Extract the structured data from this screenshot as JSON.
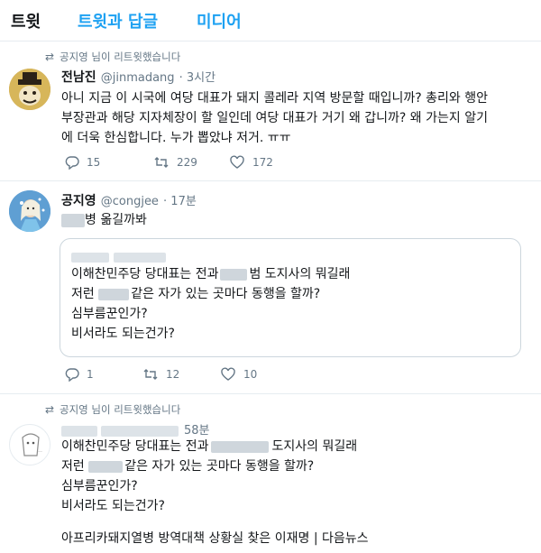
{
  "tabs": [
    "트윗",
    "트윗과 답글",
    "미디어"
  ],
  "tweet1": {
    "retweet_note": "공지영 님이 리트윗했습니다",
    "name": "전남진",
    "handle": "@jinmadang",
    "time": "· 3시간",
    "lines": [
      "아니 지금 이 시국에 여당 대표가 돼지 콜레라 지역 방문할 때입니까? 총리와 행안",
      "부장관과 해당 지자체장이 할 일인데 여당 대표가 거기 왜 갑니까? 왜 가는지 알기",
      "에 더욱 한심합니다. 누가 뽑았냐 저거. ㅠㅠ"
    ],
    "replies": "15",
    "retweets": "229",
    "likes": "172"
  },
  "tweet2": {
    "name": "공지영",
    "handle": "@congjee",
    "time": "· 17분",
    "text_suffix": "병 옮길까봐",
    "quote_lines": [
      [
        "이해찬민주당 당대표는 전과",
        "범 도지사의 뭐길래"
      ],
      [
        "저런 ",
        "같은 자가 있는 곳마다 동행을 할까?"
      ],
      [
        "심부름꾼인가?"
      ],
      [
        "비서라도 되는건가?"
      ]
    ],
    "replies": "1",
    "retweets": "12",
    "likes": "10"
  },
  "tweet3": {
    "retweet_note": "공지영 님이 리트윗했습니다",
    "time": "58분",
    "lines": [
      [
        "이해찬민주당 당대표는 전과",
        "도지사의 뭐길래"
      ],
      [
        "저런 ",
        "같은 자가 있는 곳마다 동행을 할까?"
      ],
      [
        "심부름꾼인가?"
      ],
      [
        "비서라도 되는건가?"
      ]
    ],
    "link_title": "아프리카돼지열병 방역대책 상황실 찾은 이재명 | 다음뉴스"
  },
  "colors": {
    "accent": "#1da1f2",
    "muted": "#657786",
    "border": "#e6ecf0"
  },
  "icons": [
    "retweet-icon",
    "reply-icon",
    "like-icon"
  ]
}
